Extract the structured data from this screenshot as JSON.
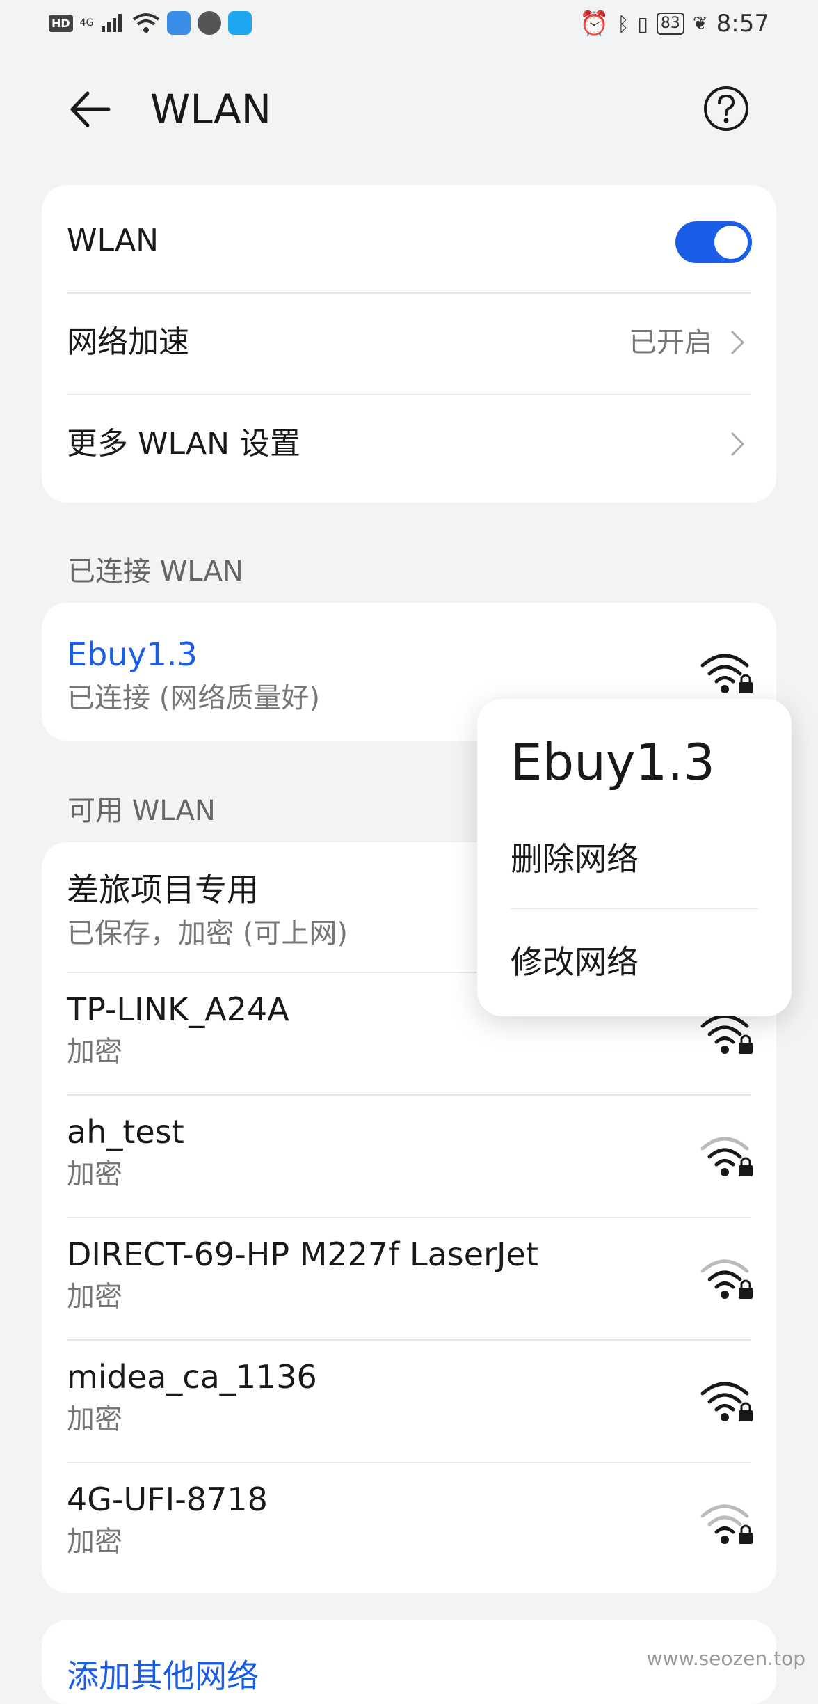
{
  "status": {
    "hd": "HD",
    "network": "4G",
    "battery": "83",
    "time": "8:57"
  },
  "header": {
    "title": "WLAN"
  },
  "settings": {
    "wlan_label": "WLAN",
    "wlan_on": true,
    "accel_label": "网络加速",
    "accel_value": "已开启",
    "more_label": "更多 WLAN 设置"
  },
  "connected": {
    "section": "已连接 WLAN",
    "name": "Ebuy1.3",
    "status": "已连接 (网络质量好)"
  },
  "available": {
    "section": "可用 WLAN",
    "networks": [
      {
        "name": "差旅项目专用",
        "status": "已保存，加密 (可上网)"
      },
      {
        "name": "TP-LINK_A24A",
        "status": "加密"
      },
      {
        "name": "ah_test",
        "status": "加密"
      },
      {
        "name": "DIRECT-69-HP M227f LaserJet",
        "status": "加密"
      },
      {
        "name": "midea_ca_1136",
        "status": "加密"
      },
      {
        "name": "4G-UFI-8718",
        "status": "加密"
      }
    ]
  },
  "add_other": "添加其他网络",
  "popup": {
    "title": "Ebuy1.3",
    "delete": "删除网络",
    "modify": "修改网络"
  },
  "watermark": "www.seozen.top",
  "colors": {
    "accent": "#1a5ee8",
    "background": "#f1f3f5"
  }
}
